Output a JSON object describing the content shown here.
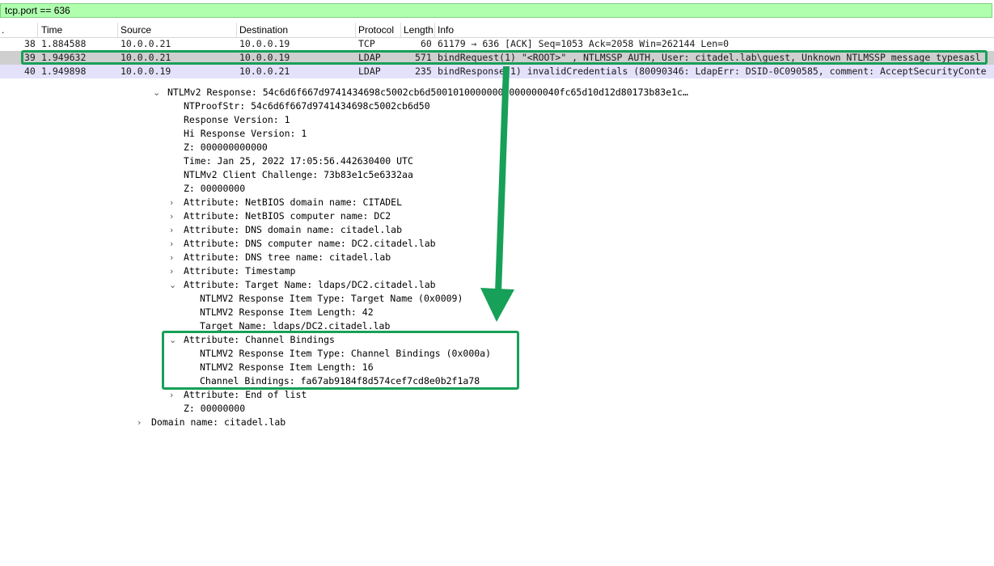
{
  "filter": {
    "value": "tcp.port == 636"
  },
  "columns": {
    "no": ".",
    "time": "Time",
    "source": "Source",
    "destination": "Destination",
    "protocol": "Protocol",
    "length": "Length",
    "info": "Info"
  },
  "packets": [
    {
      "no": "38",
      "time": "1.884588",
      "source": "10.0.0.21",
      "destination": "10.0.0.19",
      "protocol": "TCP",
      "length": "60",
      "info": "61179 → 636 [ACK] Seq=1053 Ack=2058 Win=262144 Len=0"
    },
    {
      "no": "39",
      "time": "1.949632",
      "source": "10.0.0.21",
      "destination": "10.0.0.19",
      "protocol": "LDAP",
      "length": "571",
      "info": "bindRequest(1) \"<ROOT>\" , NTLMSSP_AUTH, User: citadel.lab\\guest, Unknown NTLMSSP message typesasl"
    },
    {
      "no": "40",
      "time": "1.949898",
      "source": "10.0.0.19",
      "destination": "10.0.0.21",
      "protocol": "LDAP",
      "length": "235",
      "info": "bindResponse(1) invalidCredentials (80090346: LdapErr: DSID-0C090585, comment: AcceptSecurityConte"
    }
  ],
  "tree": {
    "ntlmv2_response": "NTLMv2 Response: 54c6d6f667d9741434698c5002cb6d50010100000000000000040fc65d10d12d80173b83e1c…",
    "ntproofstr": "NTProofStr: 54c6d6f667d9741434698c5002cb6d50",
    "response_version": "Response Version: 1",
    "hi_response_version": "Hi Response Version: 1",
    "z1": "Z: 000000000000",
    "time": "Time: Jan 25, 2022 17:05:56.442630400 UTC",
    "client_challenge": "NTLMv2 Client Challenge: 73b83e1c5e6332aa",
    "z2": "Z: 00000000",
    "attr_netbios_domain": "Attribute: NetBIOS domain name: CITADEL",
    "attr_netbios_computer": "Attribute: NetBIOS computer name: DC2",
    "attr_dns_domain": "Attribute: DNS domain name: citadel.lab",
    "attr_dns_computer": "Attribute: DNS computer name: DC2.citadel.lab",
    "attr_dns_tree": "Attribute: DNS tree name: citadel.lab",
    "attr_timestamp": "Attribute: Timestamp",
    "attr_target_name": "Attribute: Target Name: ldaps/DC2.citadel.lab",
    "tn_item_type": "NTLMV2 Response Item Type: Target Name (0x0009)",
    "tn_item_length": "NTLMV2 Response Item Length: 42",
    "tn_target_name": "Target Name: ldaps/DC2.citadel.lab",
    "attr_channel_bindings": "Attribute: Channel Bindings",
    "cb_item_type": "NTLMV2 Response Item Type: Channel Bindings (0x000a)",
    "cb_item_length": "NTLMV2 Response Item Length: 16",
    "cb_value": "Channel Bindings: fa67ab9184f8d574cef7cd8e0b2f1a78",
    "attr_end_of_list": "Attribute: End of list",
    "z3": "Z: 00000000",
    "domain_name": "Domain name: citadel.lab"
  },
  "colors": {
    "filter_bg": "#afffaf",
    "ldap_row": "#e4e1fb",
    "selected_row": "#cfcfcf",
    "annotation": "#17a058"
  }
}
